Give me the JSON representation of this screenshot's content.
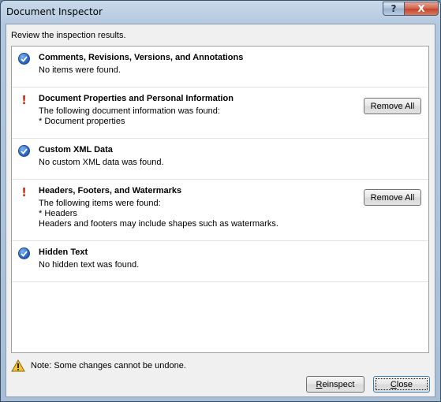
{
  "window": {
    "title": "Document Inspector",
    "help_glyph": "?",
    "close_glyph": "X"
  },
  "review_text": "Review the inspection results.",
  "results": [
    {
      "status": "ok",
      "heading": "Comments, Revisions, Versions, and Annotations",
      "lines": [
        "No items were found."
      ]
    },
    {
      "status": "found",
      "heading": "Document Properties and Personal Information",
      "lines": [
        "The following document information was found:",
        "* Document properties"
      ],
      "button": "Remove All"
    },
    {
      "status": "ok",
      "heading": "Custom XML Data",
      "lines": [
        "No custom XML data was found."
      ]
    },
    {
      "status": "found",
      "heading": "Headers, Footers, and Watermarks",
      "lines": [
        "The following items were found:",
        "* Headers",
        "Headers and footers may include shapes such as watermarks."
      ],
      "button": "Remove All"
    },
    {
      "status": "ok",
      "heading": "Hidden Text",
      "lines": [
        "No hidden text was found."
      ]
    }
  ],
  "note": "Note: Some changes cannot be undone.",
  "buttons": {
    "reinspect": "Reinspect",
    "close": "Close"
  },
  "colors": {
    "check_blue": "#2a68c8",
    "alert_red": "#d0301a",
    "warning_yellow": "#f2c230"
  }
}
